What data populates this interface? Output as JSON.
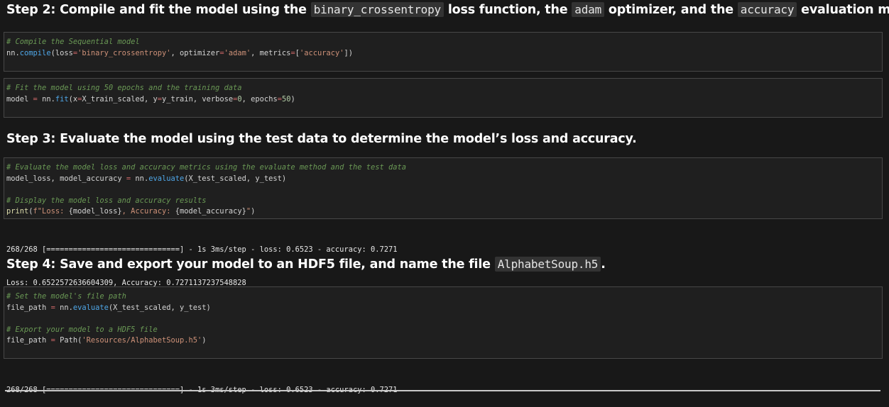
{
  "step2": {
    "prefix": "Step 2: Compile and fit the model using the ",
    "code1": "binary_crossentropy",
    "mid1": " loss function, the ",
    "code2": "adam",
    "mid2": " optimizer, and the ",
    "code3": "accuracy",
    "suffix": " evaluation metric."
  },
  "cell_compile": {
    "comment": "# Compile the Sequential model",
    "line": [
      "nn.",
      "compile",
      "(loss",
      "=",
      "'binary_crossentropy'",
      ", optimizer",
      "=",
      "'adam'",
      ", metrics",
      "=",
      "[",
      "'accuracy'",
      "])"
    ]
  },
  "cell_fit": {
    "comment": "# Fit the model using 50 epochs and the training data",
    "line": [
      "model ",
      "=",
      " nn.",
      "fit",
      "(x",
      "=",
      "X_train_scaled, y",
      "=",
      "y_train, verbose",
      "=",
      "0",
      ", epochs",
      "=",
      "50",
      ")"
    ]
  },
  "step3": {
    "text": "Step 3: Evaluate the model using the test data to determine the model’s loss and accuracy."
  },
  "cell_eval": {
    "comment1": "# Evaluate the model loss and accuracy metrics using the evaluate method and the test data",
    "line1": [
      "model_loss, model_accuracy ",
      "=",
      " nn.",
      "evaluate",
      "(X_test_scaled, y_test)"
    ],
    "comment2": "# Display the model loss and accuracy results",
    "line2": [
      "print",
      "(",
      "f\"Loss: ",
      "{model_loss}",
      ", Accuracy: ",
      "{model_accuracy}",
      "\"",
      ")"
    ]
  },
  "output_eval": {
    "line1": "268/268 [==============================] - 1s 3ms/step - loss: 0.6523 - accuracy: 0.7271",
    "line2": "Loss: 0.6522572636604309, Accuracy: 0.7271137237548828"
  },
  "step4": {
    "prefix": "Step 4: Save and export your model to an HDF5 file, and name the file ",
    "code": "AlphabetSoup.h5",
    "suffix": "."
  },
  "cell_save": {
    "comment1": "# Set the model's file path",
    "line1": [
      "file_path ",
      "=",
      " nn.",
      "evaluate",
      "(X_test_scaled, y_test)"
    ],
    "comment2": "# Export your model to a HDF5 file",
    "line2": [
      "file_path ",
      "=",
      " Path(",
      "'Resources/AlphabetSoup.h5'",
      ")"
    ]
  },
  "output_save": {
    "line1": "268/268 [==============================] - 1s 3ms/step - loss: 0.6523 - accuracy: 0.7271"
  }
}
